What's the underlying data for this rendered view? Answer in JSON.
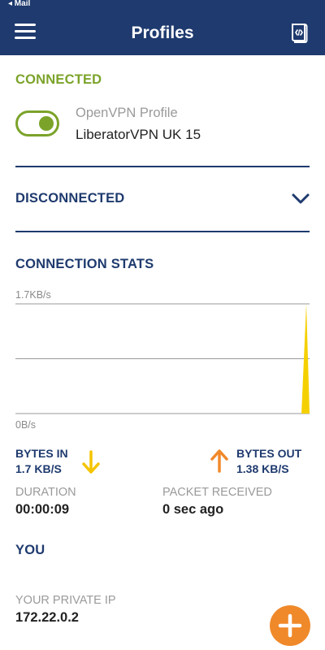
{
  "status_bar": {
    "back_app": "◂ Mail"
  },
  "header": {
    "title": "Profiles"
  },
  "connected": {
    "label": "CONNECTED",
    "profile_type": "OpenVPN Profile",
    "profile_name": "LiberatorVPN UK 15",
    "toggle_on": true
  },
  "disconnected": {
    "label": "DISCONNECTED"
  },
  "stats": {
    "label": "CONNECTION STATS",
    "bytes_in_label": "BYTES IN",
    "bytes_in_value": "1.7 KB/S",
    "bytes_out_label": "BYTES OUT",
    "bytes_out_value": "1.38 KB/S",
    "duration_label": "DURATION",
    "duration_value": "00:00:09",
    "packet_label": "PACKET RECEIVED",
    "packet_value": "0 sec ago"
  },
  "you": {
    "label": "YOU",
    "private_ip_label": "YOUR PRIVATE IP",
    "private_ip_value": "172.22.0.2"
  },
  "chart_data": {
    "type": "area",
    "ylim_labels": [
      "0B/s",
      "1.7KB/s"
    ],
    "series": [
      {
        "values": [
          0,
          0,
          0,
          0,
          0,
          0,
          0,
          0,
          1.7
        ]
      }
    ],
    "grid": true
  },
  "colors": {
    "header": "#1e3a6e",
    "connected_green": "#7ba32a",
    "bytes_in_arrow": "#f5c400",
    "bytes_out_arrow": "#f0892a",
    "chart_fill": "#f5d000",
    "fab": "#f0892a"
  },
  "icons": {
    "menu": "hamburger-menu-icon",
    "log": "log-file-icon",
    "chevron": "chevron-down-icon",
    "bytes_in": "arrow-down-icon",
    "bytes_out": "arrow-up-icon",
    "add": "plus-icon"
  }
}
